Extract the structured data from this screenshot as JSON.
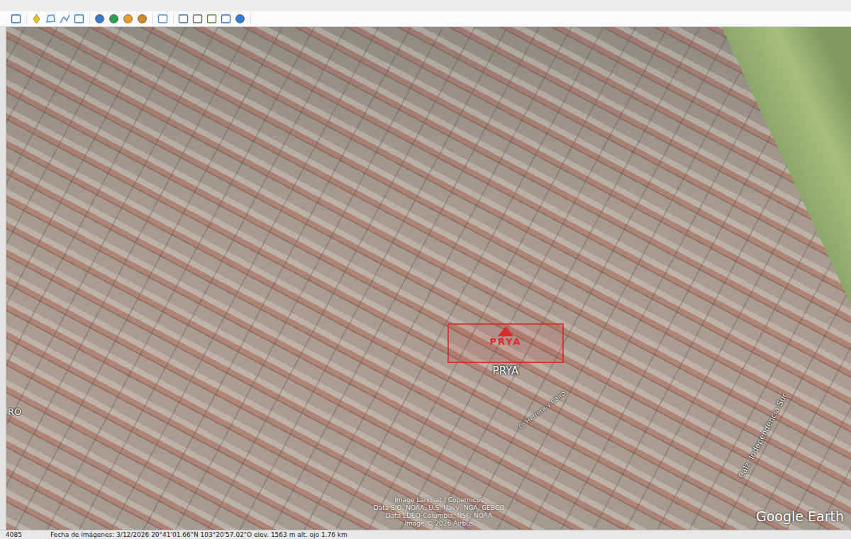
{
  "window": {
    "title": "Google Earth"
  },
  "map": {
    "placemarks": [
      {
        "logo_text": "PRYA",
        "label": "PRYA"
      }
    ],
    "street_labels": [
      {
        "text": "Calz. Independencia Sur",
        "kind": "avenue"
      },
      {
        "text": "C. Herrera y Cairo",
        "kind": "street"
      },
      {
        "text": "RO",
        "kind": "edge"
      }
    ],
    "attribution": [
      "Image Landsat / Copernicus",
      "Data SIO, NOAA, U.S. Navy, NGA, GEBCO",
      "Data LDEO-Columbia, NSF, NOAA",
      "Image © 2026 Airbus"
    ],
    "brand": "Google Earth"
  },
  "status_bar": {
    "scale": "4085",
    "text": "Fecha de imágenes: 3/12/2026    20°41'01.66\"N  103°20'57.02\"O  elev. 1563 m  alt. ojo 1.76 km"
  }
}
